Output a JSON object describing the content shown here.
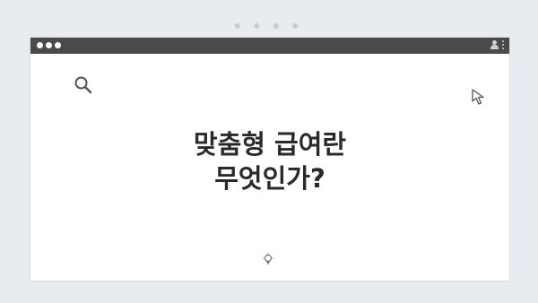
{
  "window": {
    "title_line1": "맞춤형 급여란",
    "title_line2": "무엇인가?"
  },
  "icons": {
    "top_dots": "dots-indicator",
    "search": "search-icon",
    "cursor": "cursor-icon",
    "bulb": "bulb-icon",
    "user": "user-icon",
    "menu": "kebab-menu-icon"
  },
  "colors": {
    "background": "#e8ebef",
    "titlebar": "#4a4a4a",
    "window_bg": "#ffffff",
    "text": "#2a2a2a"
  }
}
